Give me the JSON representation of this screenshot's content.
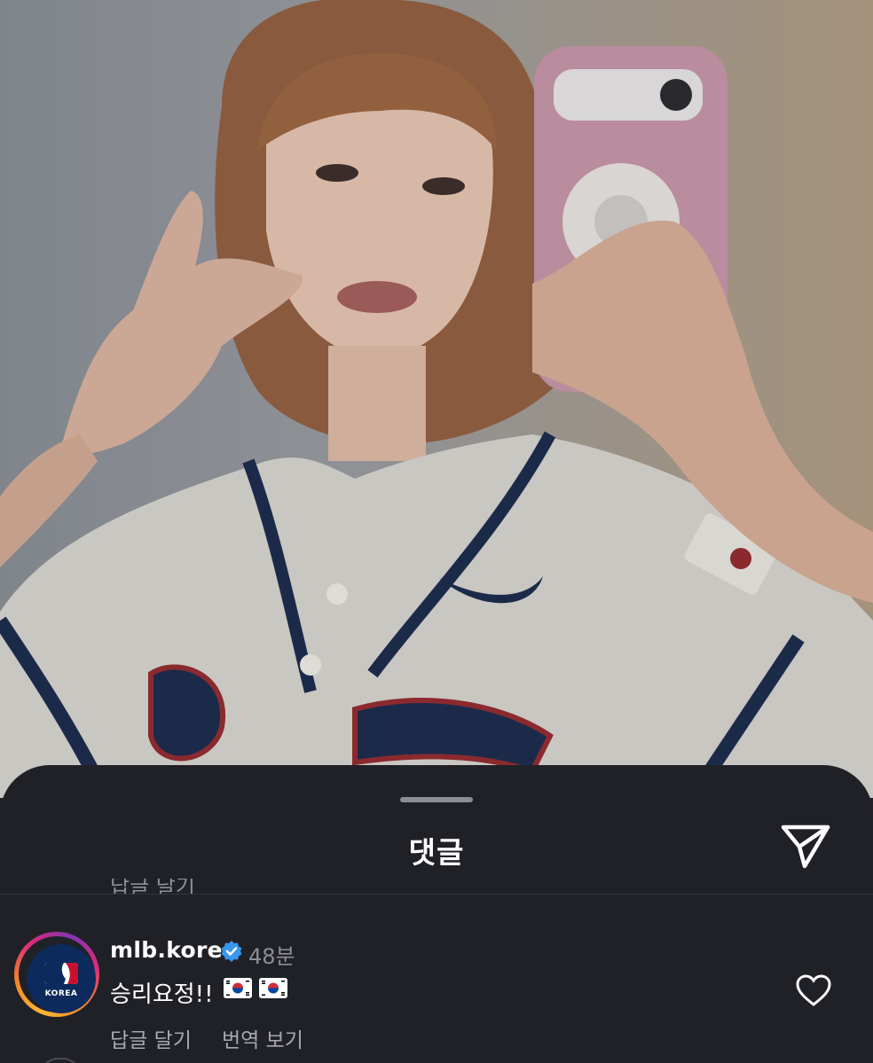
{
  "sheet": {
    "title": "댓글",
    "share_icon": "send-icon",
    "cut_previous_text": "답글 달기"
  },
  "comment": {
    "username": "mlb.korea",
    "verified_icon": "verified-badge-icon",
    "time": "48분",
    "text": "승리요정!!",
    "flags": [
      "🇰🇷",
      "🇰🇷"
    ],
    "avatar_label": "KOREA",
    "reply_label": "답글 달기",
    "translate_label": "번역 보기",
    "like_icon": "heart-icon"
  },
  "colors": {
    "sheet_bg": "#202127",
    "text_primary": "#ffffff",
    "text_secondary": "#8e8f95",
    "verified_blue": "#3897f0"
  }
}
